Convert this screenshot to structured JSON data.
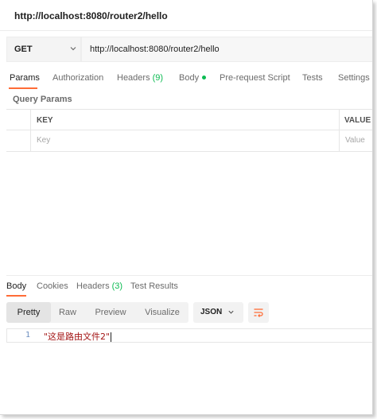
{
  "request": {
    "title": "http://localhost:8080/router2/hello",
    "method": "GET",
    "url": "http://localhost:8080/router2/hello"
  },
  "request_tabs": [
    {
      "label": "Params"
    },
    {
      "label": "Authorization"
    },
    {
      "label": "Headers",
      "count": "(9)"
    },
    {
      "label": "Body"
    },
    {
      "label": "Pre-request Script"
    },
    {
      "label": "Tests"
    },
    {
      "label": "Settings"
    }
  ],
  "query_params": {
    "title": "Query Params",
    "columns": [
      "KEY",
      "VALUE"
    ],
    "placeholders": {
      "key": "Key",
      "value": "Value"
    }
  },
  "response_tabs": [
    {
      "label": "Body"
    },
    {
      "label": "Cookies"
    },
    {
      "label": "Headers",
      "count": "(3)"
    },
    {
      "label": "Test Results"
    }
  ],
  "view_modes": [
    "Pretty",
    "Raw",
    "Preview",
    "Visualize"
  ],
  "format": "JSON",
  "response_body": {
    "line_number": "1",
    "text": "\"这是路由文件2\""
  },
  "colors": {
    "accent": "#ff6c37",
    "green": "#0cbb52",
    "string": "#a31515"
  },
  "icons": {
    "method_dropdown": "chevron-down-icon",
    "format_dropdown": "chevron-down-icon",
    "wrap": "wrap-lines-icon"
  }
}
